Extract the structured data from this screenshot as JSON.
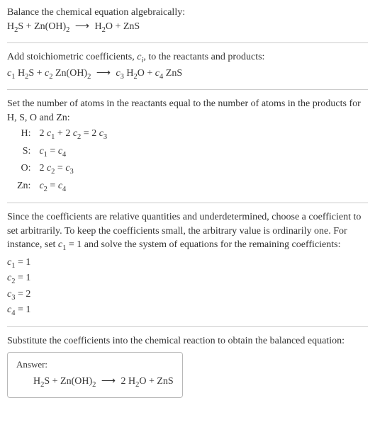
{
  "intro": {
    "line1": "Balance the chemical equation algebraically:"
  },
  "reaction_plain": {
    "r1": "H",
    "r1s": "2",
    "r1b": "S + Zn(OH)",
    "r1s2": "2",
    "arrow": "⟶",
    "p1": "H",
    "p1s": "2",
    "p1b": "O + ZnS"
  },
  "stoich_intro": "Add stoichiometric coefficients, ",
  "stoich_ci": "c",
  "stoich_ci_sub": "i",
  "stoich_intro2": ", to the reactants and products:",
  "reaction_coeff": {
    "c1": "c",
    "c1s": "1",
    "sp1": " H",
    "sp1s": "2",
    "sp1b": "S + ",
    "c2": "c",
    "c2s": "2",
    "sp2": " Zn(OH)",
    "sp2s": "2",
    "arrow": "⟶",
    "c3": "c",
    "c3s": "3",
    "sp3": " H",
    "sp3s": "2",
    "sp3b": "O + ",
    "c4": "c",
    "c4s": "4",
    "sp4": " ZnS"
  },
  "atoms_intro": "Set the number of atoms in the reactants equal to the number of atoms in the products for H, S, O and Zn:",
  "eq_rows": [
    {
      "label": "H:",
      "lhs_a": "2 ",
      "c_a": "c",
      "cs_a": "1",
      "mid": " + 2 ",
      "c_b": "c",
      "cs_b": "2",
      "eq": " = 2 ",
      "c_c": "c",
      "cs_c": "3"
    },
    {
      "label": "S:",
      "c_a": "c",
      "cs_a": "1",
      "eq": " = ",
      "c_c": "c",
      "cs_c": "4"
    },
    {
      "label": "O:",
      "lhs_a": "2 ",
      "c_a": "c",
      "cs_a": "2",
      "eq": " = ",
      "c_c": "c",
      "cs_c": "3"
    },
    {
      "label": "Zn:",
      "c_a": "c",
      "cs_a": "2",
      "eq": " = ",
      "c_c": "c",
      "cs_c": "4"
    }
  ],
  "choose_text1": "Since the coefficients are relative quantities and underdetermined, choose a coefficient to set arbitrarily. To keep the coefficients small, the arbitrary value is ordinarily one. For instance, set ",
  "choose_c": "c",
  "choose_cs": "1",
  "choose_text2": " = 1 and solve the system of equations for the remaining coefficients:",
  "solutions": [
    {
      "c": "c",
      "cs": "1",
      "val": " = 1"
    },
    {
      "c": "c",
      "cs": "2",
      "val": " = 1"
    },
    {
      "c": "c",
      "cs": "3",
      "val": " = 2"
    },
    {
      "c": "c",
      "cs": "4",
      "val": " = 1"
    }
  ],
  "subst_text": "Substitute the coefficients into the chemical reaction to obtain the balanced equation:",
  "answer": {
    "label": "Answer:",
    "r1": "H",
    "r1s": "2",
    "r1b": "S + Zn(OH)",
    "r1s2": "2",
    "arrow": "⟶",
    "p_pre": "2 ",
    "p1": "H",
    "p1s": "2",
    "p1b": "O + ZnS"
  },
  "chart_data": {
    "type": "table",
    "title": "Balance H2S + Zn(OH)2 -> H2O + ZnS",
    "element_balance": [
      {
        "element": "H",
        "equation": "2 c1 + 2 c2 = 2 c3"
      },
      {
        "element": "S",
        "equation": "c1 = c4"
      },
      {
        "element": "O",
        "equation": "2 c2 = c3"
      },
      {
        "element": "Zn",
        "equation": "c2 = c4"
      }
    ],
    "solution": {
      "c1": 1,
      "c2": 1,
      "c3": 2,
      "c4": 1
    },
    "balanced_equation": "H2S + Zn(OH)2 -> 2 H2O + ZnS"
  }
}
